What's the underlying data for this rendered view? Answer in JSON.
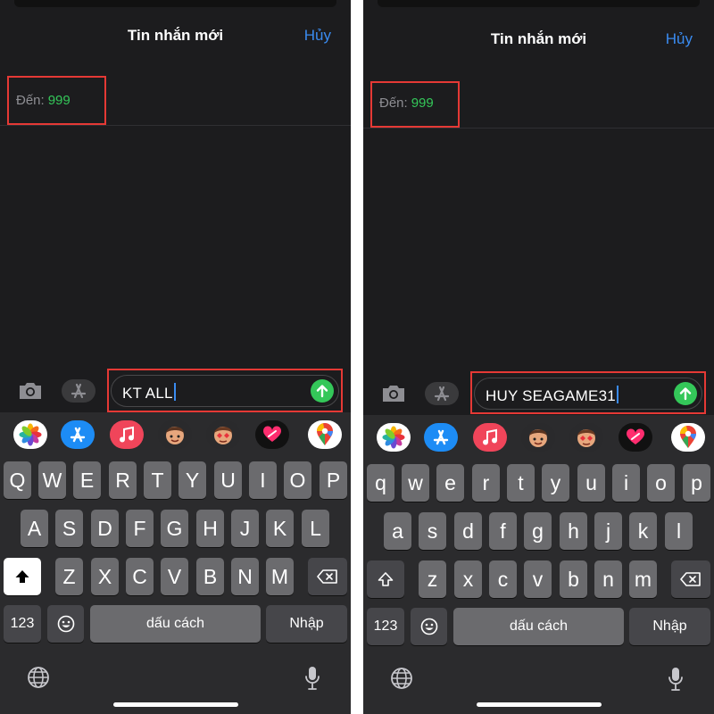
{
  "colors": {
    "background": "#1c1c1e",
    "accent_blue": "#3a8bf0",
    "recipient_green": "#34c759",
    "send_green": "#34c759",
    "highlight_red": "#e53935"
  },
  "screens": [
    {
      "header": {
        "title": "Tin nhắn mới",
        "cancel": "Hủy"
      },
      "recipient": {
        "label": "Đến:",
        "value": "999"
      },
      "compose": {
        "text": "KT ALL"
      },
      "apps": [
        "photos-icon",
        "appstore-icon",
        "music-icon",
        "memoji-icon",
        "memoji-sticker-icon",
        "digital-touch-icon",
        "google-maps-icon"
      ],
      "keyboard": {
        "row1": [
          "Q",
          "W",
          "E",
          "R",
          "T",
          "Y",
          "U",
          "I",
          "O",
          "P"
        ],
        "row2": [
          "A",
          "S",
          "D",
          "F",
          "G",
          "H",
          "J",
          "K",
          "L"
        ],
        "row3": [
          "Z",
          "X",
          "C",
          "V",
          "B",
          "N",
          "M"
        ],
        "numbers": "123",
        "space": "dấu cách",
        "return": "Nhập"
      }
    },
    {
      "header": {
        "title": "Tin nhắn mới",
        "cancel": "Hủy"
      },
      "recipient": {
        "label": "Đến:",
        "value": "999"
      },
      "compose": {
        "text": "HUY SEAGAME31"
      },
      "apps": [
        "photos-icon",
        "appstore-icon",
        "music-icon",
        "memoji-icon",
        "memoji-sticker-icon",
        "digital-touch-icon",
        "google-maps-icon"
      ],
      "keyboard": {
        "row1": [
          "q",
          "w",
          "e",
          "r",
          "t",
          "y",
          "u",
          "i",
          "o",
          "p"
        ],
        "row2": [
          "a",
          "s",
          "d",
          "f",
          "g",
          "h",
          "j",
          "k",
          "l"
        ],
        "row3": [
          "z",
          "x",
          "c",
          "v",
          "b",
          "n",
          "m"
        ],
        "numbers": "123",
        "space": "dấu cách",
        "return": "Nhập"
      }
    }
  ]
}
